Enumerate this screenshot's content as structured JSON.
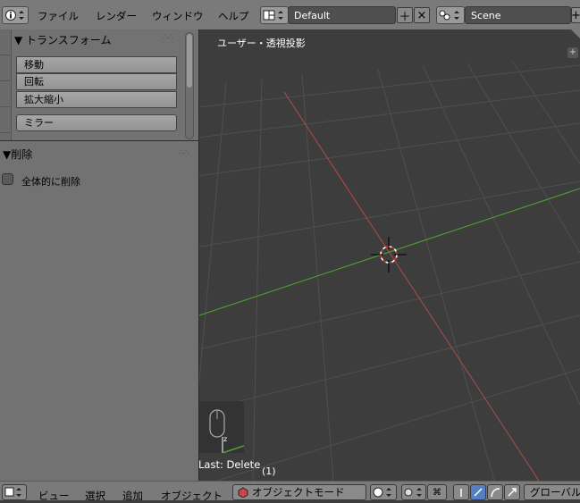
{
  "topbar": {
    "menus": [
      "ファイル",
      "レンダー",
      "ウィンドウ",
      "ヘルプ"
    ],
    "screen_layout": "Default",
    "scene": "Scene",
    "editor_icon": "info-icon",
    "add_icon": "＋",
    "close_icon": "×"
  },
  "toolshelf": {
    "transform": {
      "title": "▼ トランスフォーム",
      "buttons": [
        "移動",
        "回転",
        "拡大縮小",
        "ミラー"
      ]
    },
    "delete_panel": {
      "title": "▼削除",
      "option_label": "全体的に削除",
      "option_checked": false
    }
  },
  "viewport": {
    "label": "ユーザー・透視投影",
    "last_operation": "Last: Delete",
    "object_count": "(1)",
    "colors": {
      "x_axis": "#b34a4a",
      "y_axis": "#4ea536",
      "grid": "#4f4f4f",
      "background": "#3d3d3d"
    }
  },
  "bottombar": {
    "menus": [
      "ビュー",
      "選択",
      "追加",
      "オブジェクト"
    ],
    "mode": "オブジェクトモード",
    "orientation": "グローバル"
  }
}
